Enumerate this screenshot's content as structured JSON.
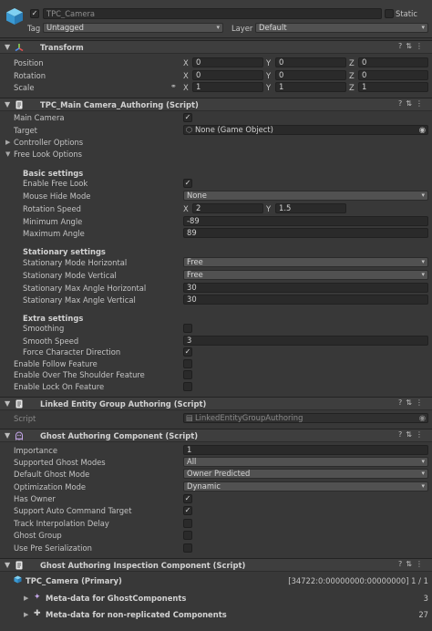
{
  "object": {
    "name": "TPC_Camera",
    "static_label": "Static",
    "tag_label": "Tag",
    "tag_value": "Untagged",
    "layer_label": "Layer",
    "layer_value": "Default",
    "active": true
  },
  "transform": {
    "title": "Transform",
    "position_label": "Position",
    "rotation_label": "Rotation",
    "scale_label": "Scale",
    "position": {
      "x": "0",
      "y": "0",
      "z": "0"
    },
    "rotation": {
      "x": "0",
      "y": "0",
      "z": "0"
    },
    "scale": {
      "x": "1",
      "y": "1",
      "z": "1"
    },
    "axis_x": "X",
    "axis_y": "Y",
    "axis_z": "Z"
  },
  "tpc": {
    "title": "TPC_Main Camera_Authoring (Script)",
    "main_camera_label": "Main Camera",
    "target_label": "Target",
    "target_value": "None (Game Object)",
    "controller_options": "Controller Options",
    "free_look_options": "Free Look Options",
    "basic_settings": "Basic settings",
    "enable_free_look": "Enable Free Look",
    "mouse_hide_mode": "Mouse Hide Mode",
    "mouse_hide_mode_value": "None",
    "rotation_speed": "Rotation Speed",
    "rotation_speed_x": "2",
    "rotation_speed_y": "1.5",
    "minimum_angle": "Minimum Angle",
    "minimum_angle_value": "-89",
    "maximum_angle": "Maximum Angle",
    "maximum_angle_value": "89",
    "stationary_settings": "Stationary settings",
    "stat_mode_h": "Stationary Mode Horizontal",
    "stat_mode_h_value": "Free",
    "stat_mode_v": "Stationary Mode Vertical",
    "stat_mode_v_value": "Free",
    "stat_max_h": "Stationary Max Angle Horizontal",
    "stat_max_h_value": "30",
    "stat_max_v": "Stationary Max Angle Vertical",
    "stat_max_v_value": "30",
    "extra_settings": "Extra settings",
    "smoothing": "Smoothing",
    "smooth_speed": "Smooth Speed",
    "smooth_speed_value": "3",
    "force_char_dir": "Force Character Direction",
    "enable_follow": "Enable Follow Feature",
    "enable_ots": "Enable Over The Shoulder Feature",
    "enable_lock_on": "Enable Lock On Feature"
  },
  "linked": {
    "title": "Linked Entity Group Authoring (Script)",
    "script_label": "Script",
    "script_value": "LinkedEntityGroupAuthoring"
  },
  "ghost": {
    "title": "Ghost Authoring Component (Script)",
    "importance": "Importance",
    "importance_value": "1",
    "supported_modes": "Supported Ghost Modes",
    "supported_modes_value": "All",
    "default_mode": "Default Ghost Mode",
    "default_mode_value": "Owner Predicted",
    "optimization_mode": "Optimization Mode",
    "optimization_mode_value": "Dynamic",
    "has_owner": "Has Owner",
    "support_auto_cmd": "Support Auto Command Target",
    "track_interp": "Track Interpolation Delay",
    "ghost_group": "Ghost Group",
    "use_pre_ser": "Use Pre Serialization"
  },
  "inspection": {
    "title": "Ghost Authoring Inspection Component (Script)",
    "primary": "TPC_Camera (Primary)",
    "hash": "[34722:0:00000000:00000000] 1 / 1",
    "meta_ghost": "Meta-data for GhostComponents",
    "meta_ghost_count": "3",
    "meta_nonrep": "Meta-data for non-replicated Components",
    "meta_nonrep_count": "27"
  },
  "icons": {
    "help": "?",
    "preset": "⇅",
    "menu": "⋮",
    "check": "✓",
    "arrow_down": "▾",
    "fold_open": "▼",
    "fold_closed": "▶"
  }
}
